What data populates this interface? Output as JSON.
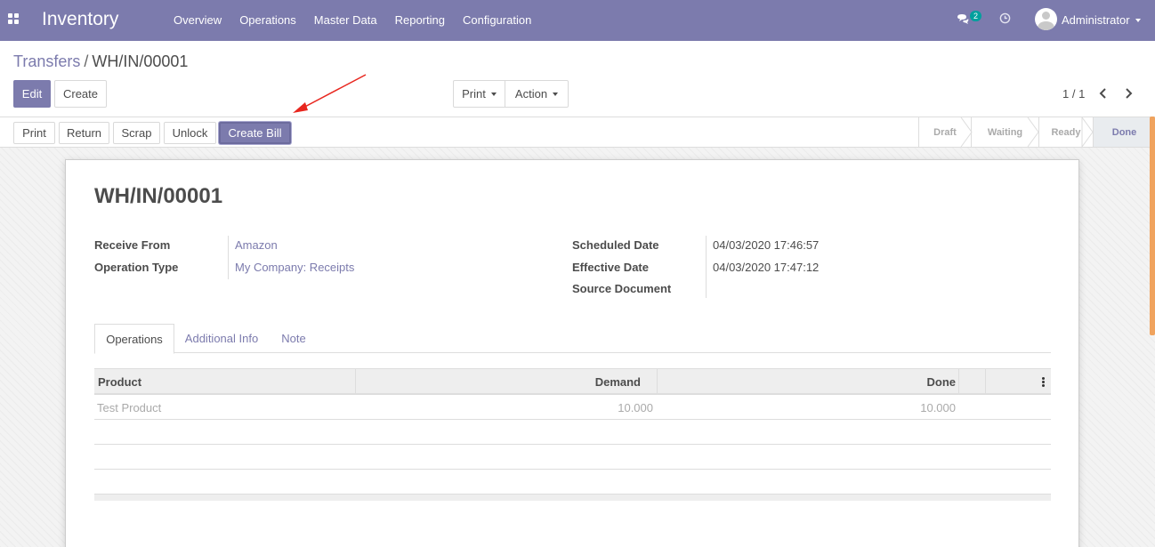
{
  "navbar": {
    "app_name": "Inventory",
    "menu": [
      "Overview",
      "Operations",
      "Master Data",
      "Reporting",
      "Configuration"
    ],
    "chat_count": "2",
    "user_name": "Administrator",
    "bg_color": "#7c7bad"
  },
  "breadcrumb": {
    "parent": "Transfers",
    "separator": "/",
    "current": "WH/IN/00001"
  },
  "control": {
    "edit_label": "Edit",
    "create_label": "Create",
    "print_label": "Print",
    "action_label": "Action",
    "pager": "1 / 1"
  },
  "statusbar": {
    "buttons": [
      "Print",
      "Return",
      "Scrap",
      "Unlock",
      "Create Bill"
    ],
    "stages": [
      "Draft",
      "Waiting",
      "Ready",
      "Done"
    ],
    "active_stage": "Done"
  },
  "record": {
    "title": "WH/IN/00001",
    "receive_from_label": "Receive From",
    "receive_from": "Amazon",
    "operation_type_label": "Operation Type",
    "operation_type": "My Company: Receipts",
    "scheduled_date_label": "Scheduled Date",
    "scheduled_date": "04/03/2020 17:46:57",
    "effective_date_label": "Effective Date",
    "effective_date": "04/03/2020 17:47:12",
    "source_document_label": "Source Document",
    "source_document": ""
  },
  "tabs": [
    "Operations",
    "Additional Info",
    "Note"
  ],
  "table": {
    "columns": [
      "Product",
      "Demand",
      "Done"
    ],
    "rows": [
      {
        "product": "Test Product",
        "demand": "10.000",
        "done": "10.000"
      }
    ]
  },
  "annotation": {
    "arrow_color": "#e8261e"
  }
}
